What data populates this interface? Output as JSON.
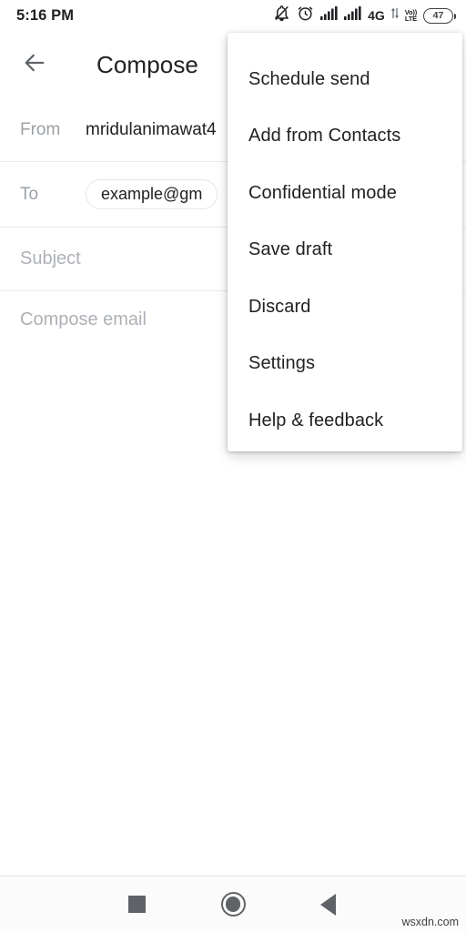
{
  "status_bar": {
    "clock": "5:16 PM",
    "network_label": "4G",
    "volte_top": "Vo))",
    "volte_bottom": "LTE",
    "battery_percent": "47",
    "icons": [
      "bell-muted-icon",
      "alarm-clock-icon",
      "signal-bars-icon",
      "signal-bars-icon",
      "network-4g-label",
      "data-arrows-icon",
      "volte-icon",
      "battery-icon"
    ]
  },
  "app_bar": {
    "back_icon": "arrow-left-icon",
    "title": "Compose"
  },
  "compose": {
    "from_label": "From",
    "from_value": "mridulanimawat4",
    "to_label": "To",
    "to_chip_value": "example@gm",
    "subject_placeholder": "Subject",
    "body_placeholder": "Compose email"
  },
  "overflow_menu": {
    "items": [
      {
        "label": "Schedule send"
      },
      {
        "label": "Add from Contacts"
      },
      {
        "label": "Confidential mode"
      },
      {
        "label": "Save draft"
      },
      {
        "label": "Discard"
      },
      {
        "label": "Settings"
      },
      {
        "label": "Help & feedback"
      }
    ]
  },
  "nav_bar": {
    "recents_icon": "square-icon",
    "home_icon": "circle-icon",
    "back_icon": "triangle-left-icon"
  },
  "watermark": "wsxdn.com",
  "colors": {
    "background": "#ffffff",
    "text_primary": "#202124",
    "text_secondary": "#9aa0a6",
    "placeholder": "#adb1b6",
    "divider": "#ebebeb",
    "nav_icon": "#5f6368",
    "nav_bg": "#fbfbfb"
  }
}
